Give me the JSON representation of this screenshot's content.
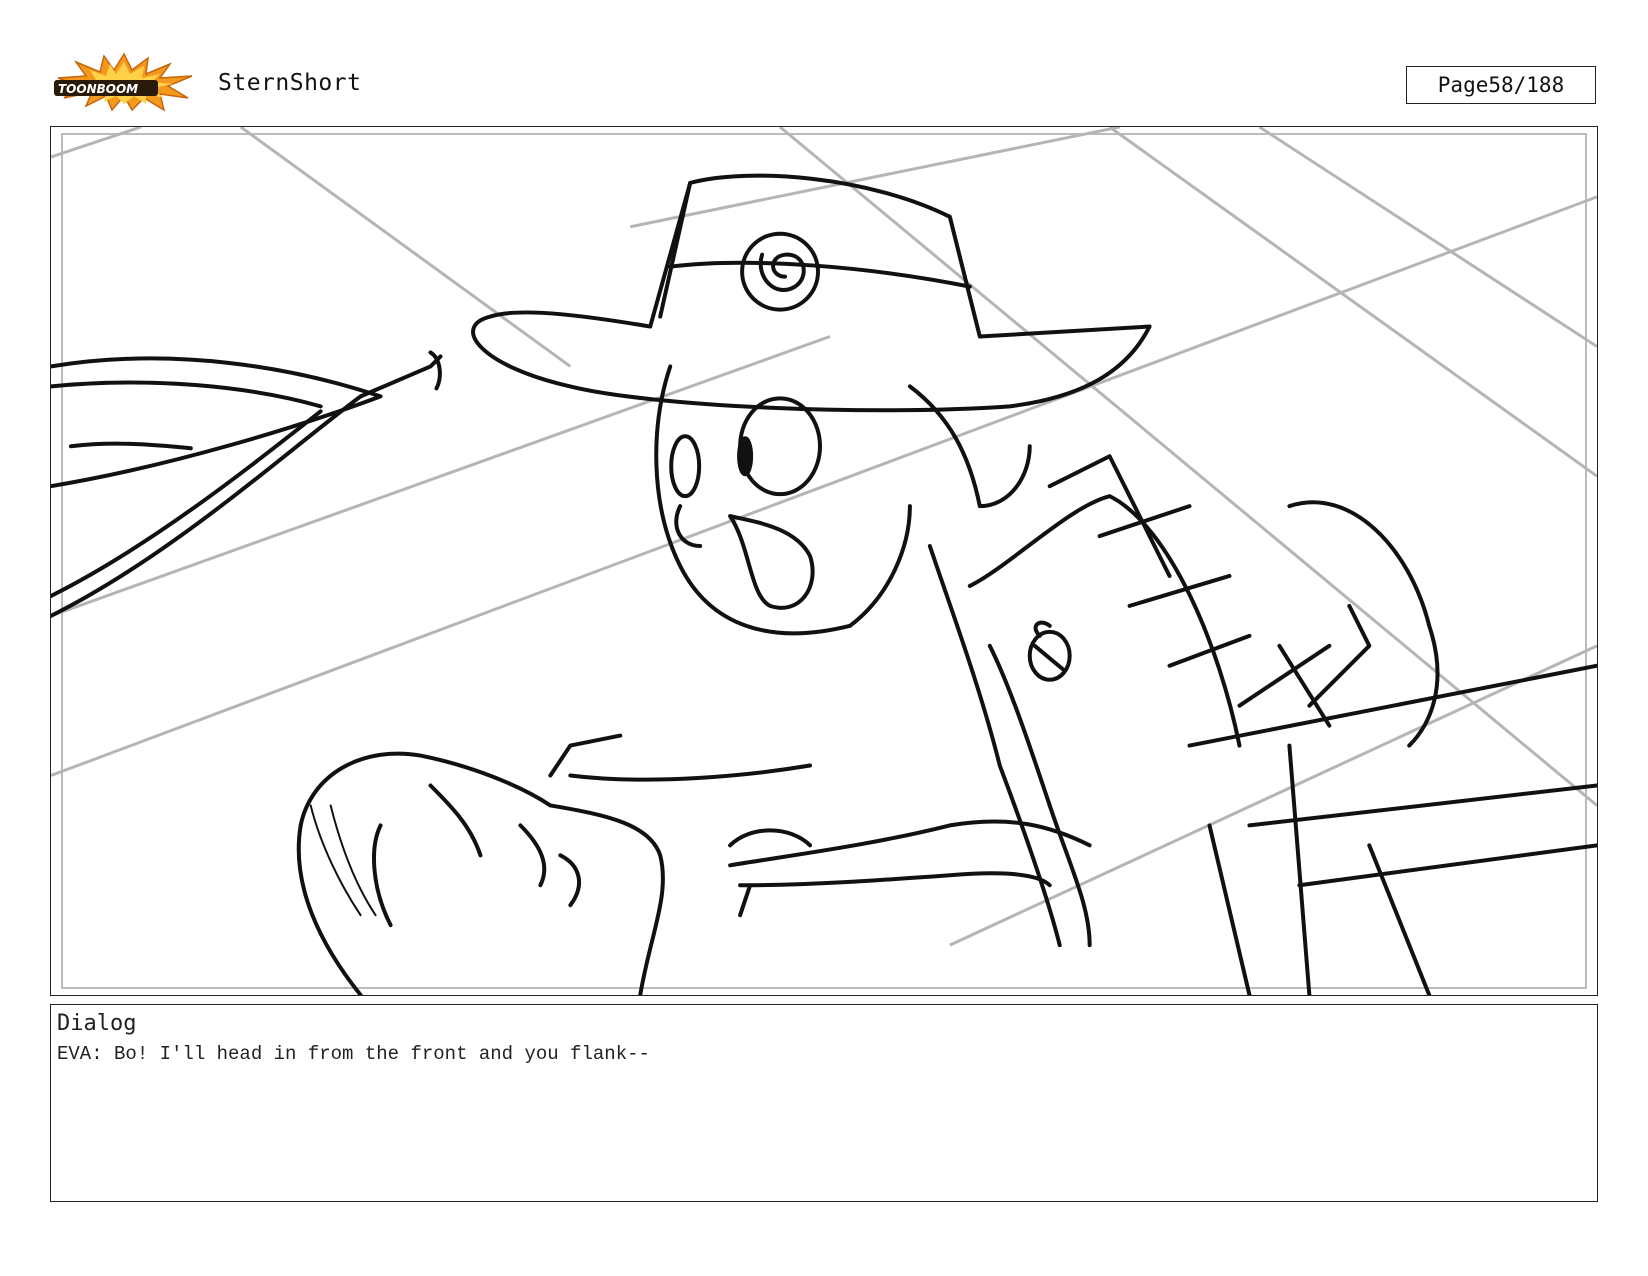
{
  "header": {
    "logo_text": "TOONBOOM",
    "project_title": "SternShort",
    "page_label": "Page",
    "page_number": "58/188"
  },
  "panel": {
    "image_description_icon": "storyboard-sketch"
  },
  "dialog": {
    "label": "Dialog",
    "text": "EVA: Bo! I'll head in from the front and you flank--"
  },
  "colors": {
    "logo_orange": "#f39a1e",
    "logo_dark": "#2a1a0a",
    "sketch_line": "#111111",
    "guide_line": "#b5b5b5"
  }
}
